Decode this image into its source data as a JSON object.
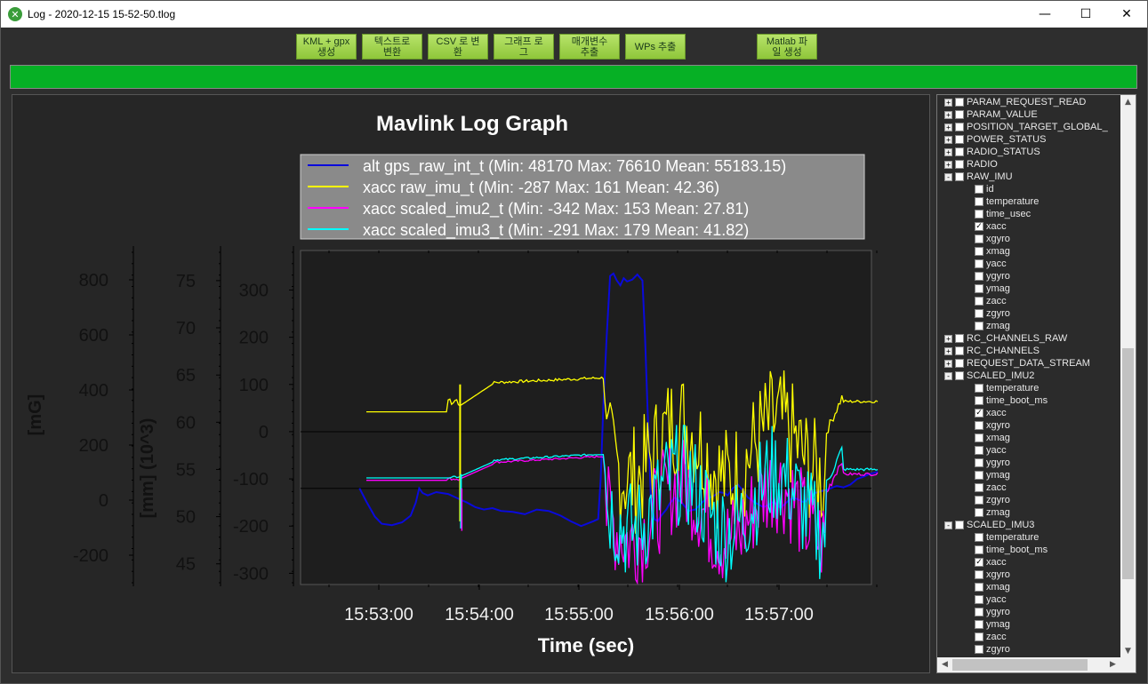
{
  "window": {
    "title": "Log - 2020-12-15 15-52-50.tlog",
    "minimize": "—",
    "maximize": "☐",
    "close": "✕"
  },
  "toolbar": {
    "buttons": [
      {
        "label": "KML + gpx\n생성"
      },
      {
        "label": "텍스트로\n변환"
      },
      {
        "label": "CSV 로 변\n환"
      },
      {
        "label": "그래프 로\n그"
      },
      {
        "label": "매개변수\n추출"
      },
      {
        "label": "WPs 추출"
      },
      {
        "label": "Matlab 파\n일 생성"
      }
    ]
  },
  "progress": {
    "value": 1.0,
    "color": "#06b025"
  },
  "chart_data": {
    "type": "line",
    "title": "Mavlink Log Graph",
    "xlabel": "Time (sec)",
    "x_ticks": [
      "15:53:00",
      "15:54:00",
      "15:55:00",
      "15:56:00",
      "15:57:00"
    ],
    "axes": [
      {
        "label": "[mG]",
        "ticks": [
          "800",
          "600",
          "400",
          "200",
          "0",
          "-200"
        ],
        "range": [
          -300,
          900
        ]
      },
      {
        "label": "[mm] (10^3)",
        "ticks": [
          "75",
          "70",
          "65",
          "60",
          "55",
          "50",
          "45"
        ],
        "range": [
          43,
          78
        ]
      },
      {
        "label": "",
        "ticks": [
          "300",
          "200",
          "100",
          "0",
          "-100",
          "-200",
          "-300"
        ],
        "range": [
          -320,
          380
        ]
      }
    ],
    "legend": [
      {
        "name": "alt gps_raw_int_t (Min: 48170 Max: 76610 Mean: 55183.15)",
        "color": "#0a0adc"
      },
      {
        "name": "xacc raw_imu_t (Min: -287 Max: 161 Mean: 42.36)",
        "color": "#ffff00"
      },
      {
        "name": "xacc scaled_imu2_t (Min: -342 Max: 153 Mean: 27.81)",
        "color": "#ff00ff"
      },
      {
        "name": "xacc scaled_imu3_t (Min: -291 Max: 179 Mean: 41.82)",
        "color": "#00ffff"
      }
    ],
    "series": [
      {
        "name": "alt",
        "color": "#0a0adc",
        "points": [
          [
            -8,
            -120
          ],
          [
            0,
            -148
          ],
          [
            10,
            -180
          ],
          [
            18,
            -195
          ],
          [
            30,
            -198
          ],
          [
            42,
            -192
          ],
          [
            52,
            -178
          ],
          [
            58,
            -150
          ],
          [
            62,
            -120
          ],
          [
            66,
            -130
          ],
          [
            72,
            -135
          ],
          [
            82,
            -128
          ],
          [
            96,
            -132
          ],
          [
            108,
            -142
          ],
          [
            118,
            -150
          ],
          [
            128,
            -160
          ],
          [
            138,
            -165
          ],
          [
            148,
            -162
          ],
          [
            158,
            -168
          ],
          [
            172,
            -170
          ],
          [
            186,
            -175
          ],
          [
            200,
            -165
          ],
          [
            214,
            -168
          ],
          [
            228,
            -178
          ],
          [
            240,
            -190
          ],
          [
            252,
            -200
          ],
          [
            266,
            -190
          ],
          [
            272,
            -185
          ],
          [
            275,
            -100
          ],
          [
            278,
            50
          ],
          [
            282,
            200
          ],
          [
            286,
            330
          ],
          [
            290,
            335
          ],
          [
            294,
            320
          ],
          [
            298,
            310
          ],
          [
            302,
            325
          ],
          [
            306,
            318
          ],
          [
            312,
            322
          ],
          [
            318,
            333
          ],
          [
            324,
            320
          ],
          [
            327,
            200
          ],
          [
            330,
            50
          ],
          [
            334,
            -150
          ],
          [
            338,
            -185
          ],
          [
            342,
            -190
          ],
          [
            346,
            -178
          ],
          [
            352,
            -165
          ],
          [
            356,
            -152
          ],
          [
            362,
            -140
          ],
          [
            370,
            -150
          ],
          [
            378,
            -168
          ],
          [
            386,
            -165
          ],
          [
            394,
            -150
          ],
          [
            400,
            -140
          ],
          [
            406,
            -138
          ],
          [
            414,
            -128
          ],
          [
            420,
            -130
          ],
          [
            424,
            -135
          ],
          [
            430,
            -120
          ],
          [
            436,
            -112
          ],
          [
            442,
            -125
          ],
          [
            448,
            -140
          ],
          [
            452,
            -145
          ],
          [
            456,
            -150
          ],
          [
            466,
            -160
          ],
          [
            472,
            -155
          ],
          [
            478,
            -148
          ],
          [
            486,
            -162
          ],
          [
            490,
            -155
          ],
          [
            496,
            -145
          ],
          [
            502,
            -140
          ],
          [
            508,
            -145
          ],
          [
            514,
            -150
          ],
          [
            520,
            -140
          ],
          [
            526,
            -130
          ],
          [
            534,
            -126
          ],
          [
            542,
            -122
          ],
          [
            552,
            -115
          ],
          [
            560,
            -118
          ],
          [
            568,
            -112
          ],
          [
            576,
            -100
          ],
          [
            584,
            -95
          ],
          [
            590,
            -90
          ],
          [
            600,
            -85
          ]
        ],
        "xmap": "norm"
      },
      {
        "name": "xacc_raw",
        "color": "#ffff00"
      },
      {
        "name": "xacc_imu2",
        "color": "#ff00ff"
      },
      {
        "name": "xacc_imu3",
        "color": "#00ffff"
      }
    ],
    "grid": false
  },
  "tree": {
    "items": [
      {
        "level": 0,
        "exp": "+",
        "label": "PARAM_REQUEST_READ",
        "checked": false
      },
      {
        "level": 0,
        "exp": "+",
        "label": "PARAM_VALUE",
        "checked": false
      },
      {
        "level": 0,
        "exp": "+",
        "label": "POSITION_TARGET_GLOBAL_",
        "checked": false
      },
      {
        "level": 0,
        "exp": "+",
        "label": "POWER_STATUS",
        "checked": false
      },
      {
        "level": 0,
        "exp": "+",
        "label": "RADIO_STATUS",
        "checked": false
      },
      {
        "level": 0,
        "exp": "+",
        "label": "RADIO",
        "checked": false
      },
      {
        "level": 0,
        "exp": "-",
        "label": "RAW_IMU",
        "checked": false
      },
      {
        "level": 1,
        "exp": "",
        "label": "id",
        "checked": false
      },
      {
        "level": 1,
        "exp": "",
        "label": "temperature",
        "checked": false
      },
      {
        "level": 1,
        "exp": "",
        "label": "time_usec",
        "checked": false
      },
      {
        "level": 1,
        "exp": "",
        "label": "xacc",
        "checked": true
      },
      {
        "level": 1,
        "exp": "",
        "label": "xgyro",
        "checked": false
      },
      {
        "level": 1,
        "exp": "",
        "label": "xmag",
        "checked": false
      },
      {
        "level": 1,
        "exp": "",
        "label": "yacc",
        "checked": false
      },
      {
        "level": 1,
        "exp": "",
        "label": "ygyro",
        "checked": false
      },
      {
        "level": 1,
        "exp": "",
        "label": "ymag",
        "checked": false
      },
      {
        "level": 1,
        "exp": "",
        "label": "zacc",
        "checked": false
      },
      {
        "level": 1,
        "exp": "",
        "label": "zgyro",
        "checked": false
      },
      {
        "level": 1,
        "exp": "",
        "label": "zmag",
        "checked": false
      },
      {
        "level": 0,
        "exp": "+",
        "label": "RC_CHANNELS_RAW",
        "checked": false
      },
      {
        "level": 0,
        "exp": "+",
        "label": "RC_CHANNELS",
        "checked": false
      },
      {
        "level": 0,
        "exp": "+",
        "label": "REQUEST_DATA_STREAM",
        "checked": false
      },
      {
        "level": 0,
        "exp": "-",
        "label": "SCALED_IMU2",
        "checked": false
      },
      {
        "level": 1,
        "exp": "",
        "label": "temperature",
        "checked": false
      },
      {
        "level": 1,
        "exp": "",
        "label": "time_boot_ms",
        "checked": false
      },
      {
        "level": 1,
        "exp": "",
        "label": "xacc",
        "checked": true
      },
      {
        "level": 1,
        "exp": "",
        "label": "xgyro",
        "checked": false
      },
      {
        "level": 1,
        "exp": "",
        "label": "xmag",
        "checked": false
      },
      {
        "level": 1,
        "exp": "",
        "label": "yacc",
        "checked": false
      },
      {
        "level": 1,
        "exp": "",
        "label": "ygyro",
        "checked": false
      },
      {
        "level": 1,
        "exp": "",
        "label": "ymag",
        "checked": false
      },
      {
        "level": 1,
        "exp": "",
        "label": "zacc",
        "checked": false
      },
      {
        "level": 1,
        "exp": "",
        "label": "zgyro",
        "checked": false
      },
      {
        "level": 1,
        "exp": "",
        "label": "zmag",
        "checked": false
      },
      {
        "level": 0,
        "exp": "-",
        "label": "SCALED_IMU3",
        "checked": false
      },
      {
        "level": 1,
        "exp": "",
        "label": "temperature",
        "checked": false
      },
      {
        "level": 1,
        "exp": "",
        "label": "time_boot_ms",
        "checked": false
      },
      {
        "level": 1,
        "exp": "",
        "label": "xacc",
        "checked": true
      },
      {
        "level": 1,
        "exp": "",
        "label": "xgyro",
        "checked": false
      },
      {
        "level": 1,
        "exp": "",
        "label": "xmag",
        "checked": false
      },
      {
        "level": 1,
        "exp": "",
        "label": "yacc",
        "checked": false
      },
      {
        "level": 1,
        "exp": "",
        "label": "ygyro",
        "checked": false
      },
      {
        "level": 1,
        "exp": "",
        "label": "ymag",
        "checked": false
      },
      {
        "level": 1,
        "exp": "",
        "label": "zacc",
        "checked": false
      },
      {
        "level": 1,
        "exp": "",
        "label": "zgyro",
        "checked": false
      }
    ]
  }
}
